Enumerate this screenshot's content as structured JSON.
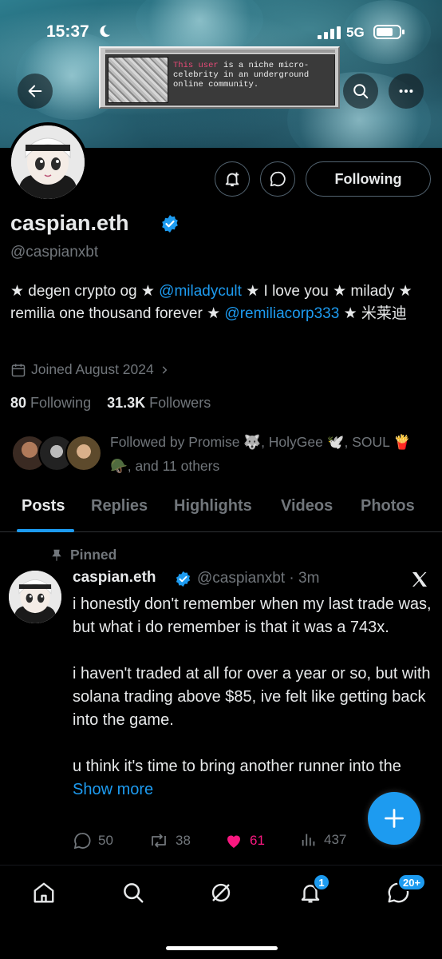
{
  "status_bar": {
    "time": "15:37",
    "network": "5G"
  },
  "popup": {
    "highlight": "This user",
    "text": " is a niche micro-celebrity in an underground online community."
  },
  "profile": {
    "display_name": "caspian.eth",
    "handle": "@caspianxbt",
    "follow_label": "Following",
    "bio": {
      "part1": "★ degen crypto og ★ ",
      "mention1": "@miladycult",
      "part2": " ★ I love you ★ milady ★ remilia one thousand forever ★ ",
      "mention2": "@remiliacorp333",
      "part3": " ★ 米莱迪"
    },
    "joined": "Joined August 2024",
    "following_count": "80",
    "following_label": "Following",
    "followers_count": "31.3K",
    "followers_label": "Followers",
    "followed_by": "Followed by Promise 🐺, HolyGee 🕊️, SOUL 🍟🪖, and 11 others"
  },
  "tabs": [
    "Posts",
    "Replies",
    "Highlights",
    "Videos",
    "Photos"
  ],
  "tweet": {
    "pinned_label": "Pinned",
    "name": "caspian.eth",
    "handle_time": "@caspianxbt · 3m",
    "body": "i honestly don't remember when my last trade was, but what i do remember is that it was a 743x.\n\ni haven't traded at all for over a year or so, but with solana trading above $85, ive felt like getting back into the game.\n\nu think it's time to bring another runner into the ",
    "show_more": "Show more",
    "replies": "50",
    "retweets": "38",
    "likes": "61",
    "views": "437"
  },
  "nav": {
    "notifications_badge": "1",
    "messages_badge": "20+"
  },
  "colors": {
    "accent": "#1d9bf0",
    "like": "#f91880",
    "muted": "#71767b"
  }
}
